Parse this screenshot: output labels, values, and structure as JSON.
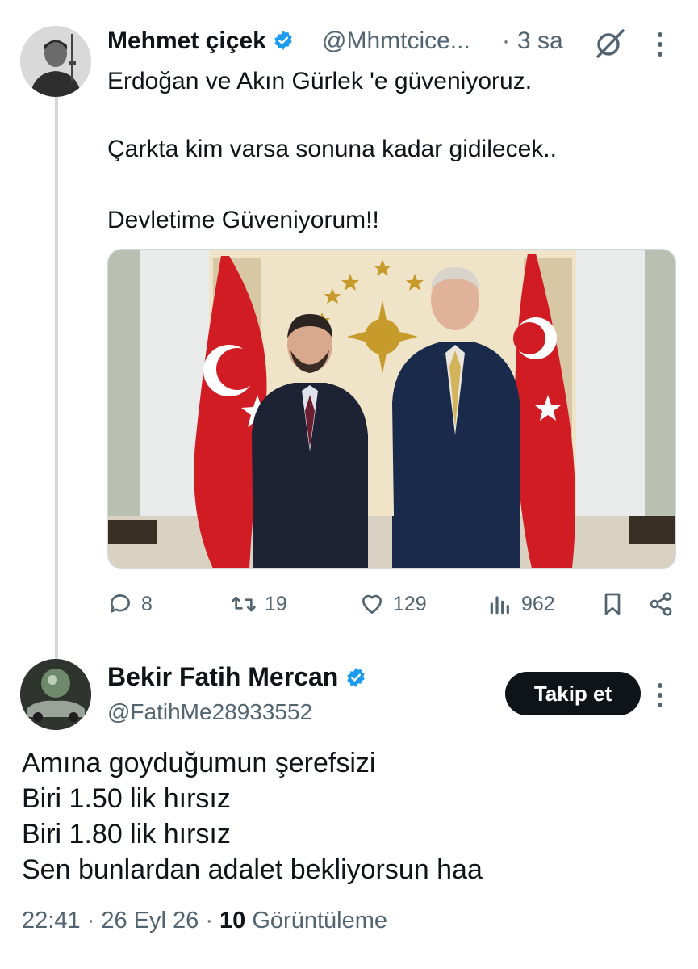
{
  "tweet1": {
    "display_name": "Mehmet çiçek",
    "handle": "@Mhmtcice...",
    "separator": "·",
    "time": "3 sa",
    "lines": [
      "Erdoğan ve Akın Gürlek 'e güveniyoruz.",
      "Çarkta kim varsa sonuna kadar gidilecek..",
      "Devletime Güveniyorum!!"
    ],
    "actions": {
      "replies": "8",
      "reposts": "19",
      "likes": "129",
      "views": "962"
    },
    "icons": [
      "verified-badge-icon",
      "grok-icon",
      "more-icon",
      "reply-icon",
      "repost-icon",
      "like-icon",
      "views-icon",
      "bookmark-icon",
      "share-icon"
    ]
  },
  "tweet2": {
    "display_name": "Bekir Fatih Mercan",
    "handle": "@FatihMe28933552",
    "follow_label": "Takip et",
    "lines": [
      "Amına goyduğumun şerefsizi",
      "Biri 1.50 lik hırsız",
      "Biri 1.80 lik hırsız",
      "Sen bunlardan adalet bekliyorsun haa"
    ],
    "timestamp": "22:41 · 26 Eyl 26 ·",
    "view_count": "10",
    "view_label": "Görüntüleme"
  },
  "colors": {
    "verified": "#1d9bf0",
    "secondary_text": "#536471",
    "primary_text": "#0f1419",
    "flag_red": "#d21c24"
  }
}
